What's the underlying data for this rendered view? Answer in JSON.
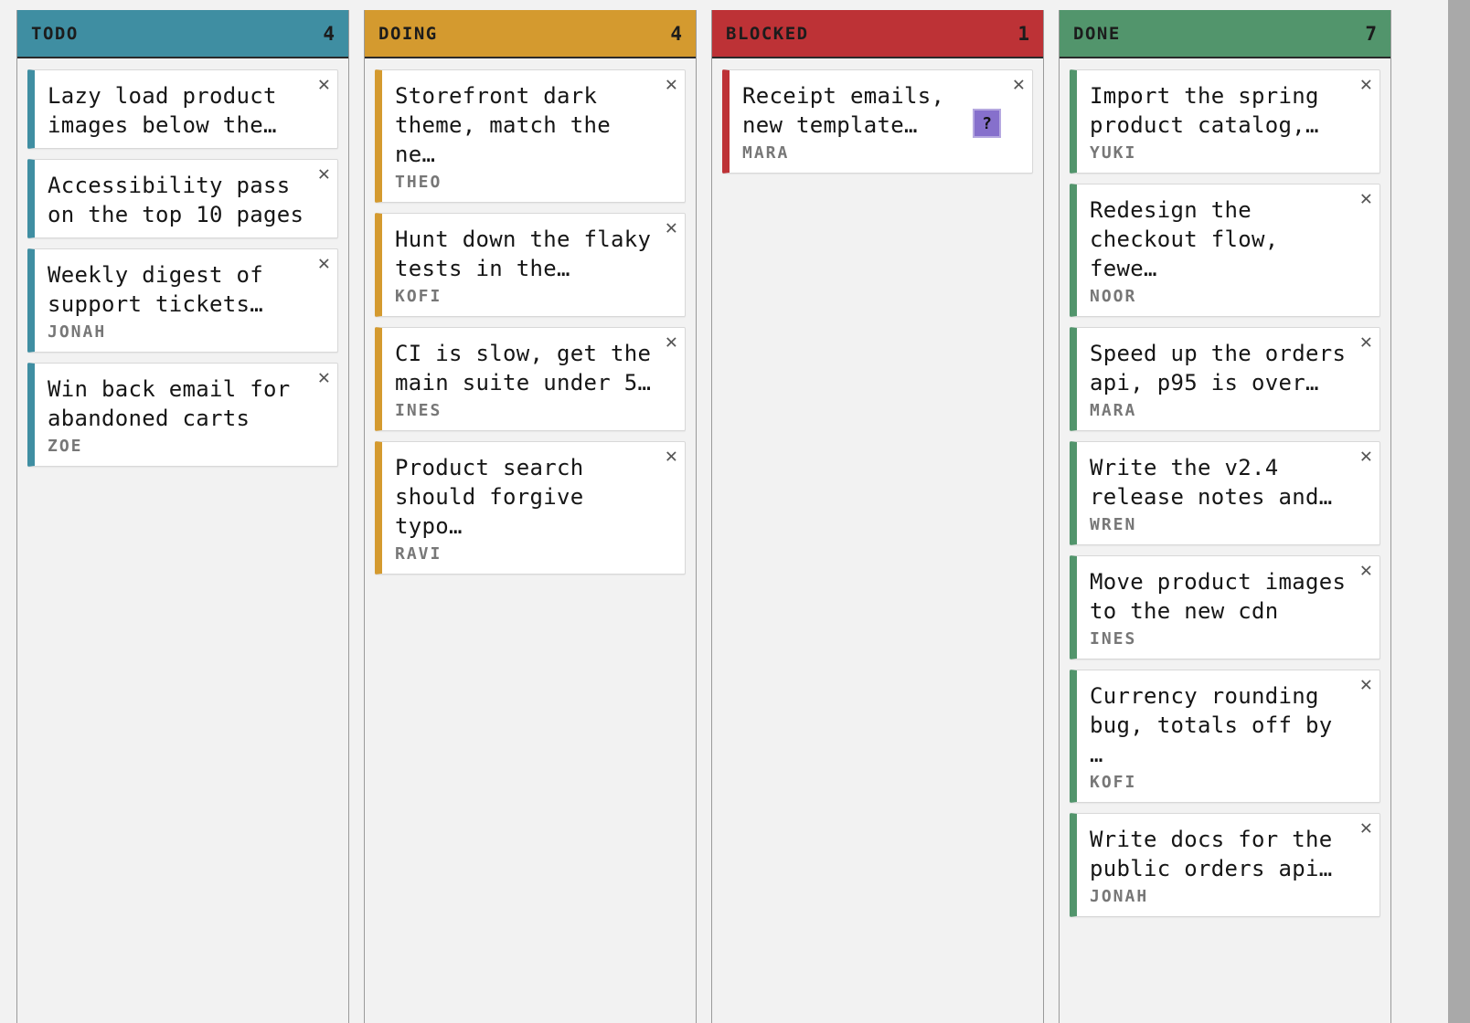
{
  "columns": [
    {
      "id": "todo",
      "title": "TODO",
      "count": "4",
      "color": "#3f8ea2",
      "cards": [
        {
          "title": "Lazy load product\nimages below the…",
          "owner": ""
        },
        {
          "title": "Accessibility pass\non the top 10 pages",
          "owner": ""
        },
        {
          "title": "Weekly digest of\nsupport tickets…",
          "owner": "JONAH"
        },
        {
          "title": "Win back email for\nabandoned carts",
          "owner": "ZOE"
        }
      ]
    },
    {
      "id": "doing",
      "title": "DOING",
      "count": "4",
      "color": "#d49a2f",
      "cards": [
        {
          "title": "Storefront dark\ntheme, match the ne…",
          "owner": "THEO"
        },
        {
          "title": "Hunt down the flaky\ntests in the…",
          "owner": "KOFI"
        },
        {
          "title": "CI is slow, get the\nmain suite under 5…",
          "owner": "INES"
        },
        {
          "title": "Product search\nshould forgive typo…",
          "owner": "RAVI"
        }
      ]
    },
    {
      "id": "blocked",
      "title": "BLOCKED",
      "count": "1",
      "color": "#bd3236",
      "cards": [
        {
          "title": "Receipt emails,\nnew template…",
          "owner": "MARA",
          "help": "?"
        }
      ]
    },
    {
      "id": "done",
      "title": "DONE",
      "count": "7",
      "color": "#52956c",
      "cards": [
        {
          "title": "Import the spring\nproduct catalog,…",
          "owner": "YUKI"
        },
        {
          "title": "Redesign the\ncheckout flow, fewe…",
          "owner": "NOOR"
        },
        {
          "title": "Speed up the orders\napi, p95 is over…",
          "owner": "MARA"
        },
        {
          "title": "Write the v2.4\nrelease notes and…",
          "owner": "WREN"
        },
        {
          "title": "Move product images\nto the new cdn",
          "owner": "INES"
        },
        {
          "title": "Currency rounding\nbug, totals off by …",
          "owner": "KOFI"
        },
        {
          "title": "Write docs for the\npublic orders api…",
          "owner": "JONAH"
        }
      ]
    }
  ],
  "icons": {
    "close": "close-icon",
    "close_glyph": "✕"
  },
  "colors": {
    "help_badge": "#8670cc"
  }
}
